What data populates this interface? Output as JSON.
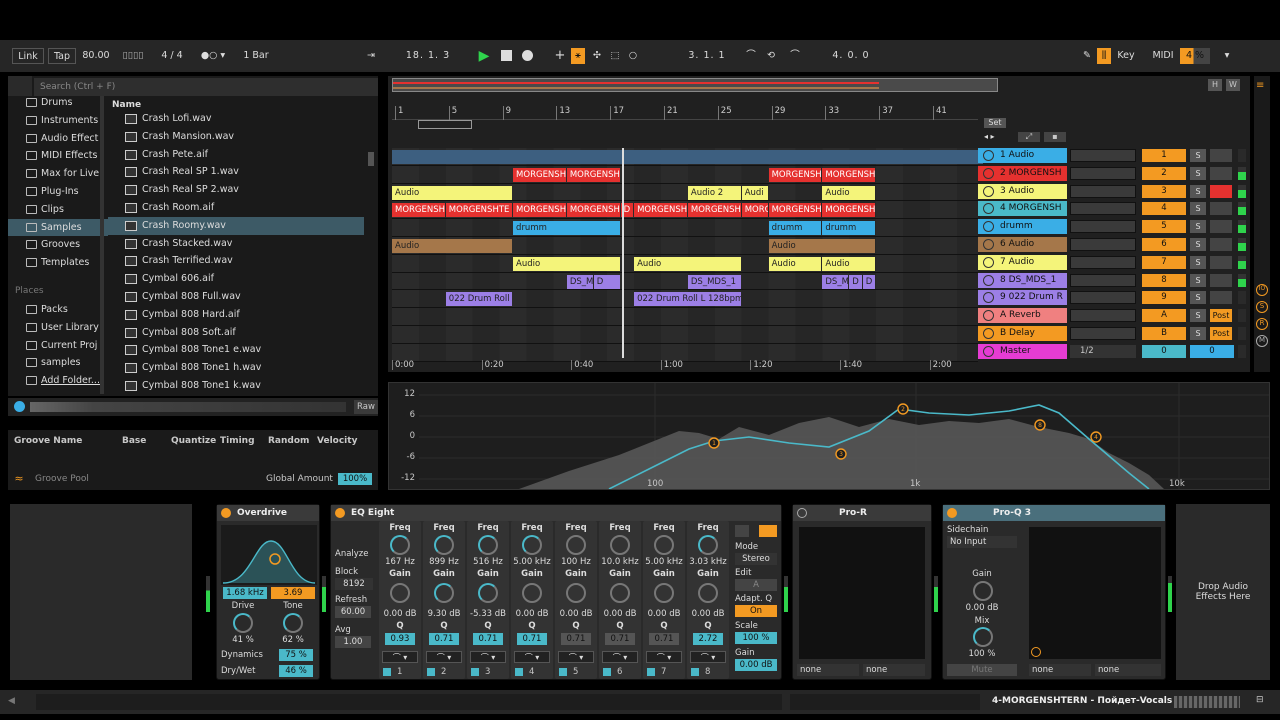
{
  "transport": {
    "link": "Link",
    "tap": "Tap",
    "tempo": "80.00",
    "meter": "4 / 4",
    "quant": "1 Bar",
    "pos": "18. 1. 3",
    "loop_start": "3. 1. 1",
    "loop_len": "4. 0. 0",
    "key": "Key",
    "midi": "MIDI",
    "cpu": "4 %"
  },
  "browser": {
    "search": "Search (Ctrl + F)",
    "name_header": "Name",
    "categories": [
      "Drums",
      "Instruments",
      "Audio Effect",
      "MIDI Effects",
      "Max for Live",
      "Plug-Ins",
      "Clips",
      "Samples",
      "Grooves",
      "Templates"
    ],
    "places_title": "Places",
    "places": [
      "Packs",
      "User Library",
      "Current Proj",
      "samples",
      "Add Folder..."
    ],
    "files": [
      "Crash Lofi.wav",
      "Crash Mansion.wav",
      "Crash Pete.aif",
      "Crash Real SP 1.wav",
      "Crash Real SP 2.wav",
      "Crash Room.aif",
      "Crash Roomy.wav",
      "Crash Stacked.wav",
      "Crash Terrified.wav",
      "Cymbal 606.aif",
      "Cymbal 808 Full.wav",
      "Cymbal 808 Hard.aif",
      "Cymbal 808 Soft.aif",
      "Cymbal 808 Tone1 e.wav",
      "Cymbal 808 Tone1 h.wav",
      "Cymbal 808 Tone1 k.wav"
    ],
    "raw": "Raw"
  },
  "groove": {
    "headers": [
      "Groove Name",
      "Base",
      "Quantize",
      "Timing",
      "Random",
      "Velocity"
    ],
    "pool": "Groove Pool",
    "global": "Global Amount",
    "amount": "100%"
  },
  "ruler": [
    "1",
    "5",
    "9",
    "13",
    "17",
    "21",
    "25",
    "29",
    "33",
    "37",
    "41"
  ],
  "timeline": [
    "0:00",
    "0:20",
    "0:40",
    "1:00",
    "1:20",
    "1:40",
    "2:00"
  ],
  "set": "Set",
  "clips": {
    "morgensh": "MORGENSH",
    "morgenshte": "MORGENSHTE",
    "morge": "MORGE",
    "audio": "Audio",
    "audio2": "Audio 2",
    "audi": "Audi",
    "drumm": "drumm",
    "drum_roll": "022 Drum Roll",
    "drum_roll_long": "022 Drum Roll L 128bpm",
    "ds": "DS_M",
    "ds_mds": "DS_MDS_1",
    "d": "D"
  },
  "tracks": [
    {
      "name": "1 Audio",
      "num": "1"
    },
    {
      "name": "2 MORGENSH",
      "num": "2"
    },
    {
      "name": "3 Audio",
      "num": "3"
    },
    {
      "name": "4 MORGENSH",
      "num": "4"
    },
    {
      "name": "drumm",
      "num": "5"
    },
    {
      "name": "6 Audio",
      "num": "6"
    },
    {
      "name": "7 Audio",
      "num": "7"
    },
    {
      "name": "8 DS_MDS_1",
      "num": "8"
    },
    {
      "name": "9 022 Drum R",
      "num": "9"
    },
    {
      "name": "A Reverb",
      "num": "A"
    },
    {
      "name": "B Delay",
      "num": "B"
    },
    {
      "name": "Master",
      "num": "0"
    }
  ],
  "mixer": {
    "solo": "S",
    "post": "Post",
    "ratio": "1/2",
    "master_val": "0"
  },
  "eq_display": {
    "db": [
      "12",
      "6",
      "0",
      "-6",
      "-12"
    ],
    "freq": [
      "100",
      "1k",
      "10k"
    ]
  },
  "devices": {
    "overdrive": {
      "title": "Overdrive",
      "freq": "1.68 kHz",
      "width": "3.69",
      "drive_lbl": "Drive",
      "tone_lbl": "Tone",
      "drive": "41 %",
      "tone": "62 %",
      "dyn_lbl": "Dynamics",
      "dyn": "75 %",
      "dw_lbl": "Dry/Wet",
      "dw": "46 %"
    },
    "eq8": {
      "title": "EQ Eight",
      "analyze": "Analyze",
      "block_lbl": "Block",
      "block": "8192",
      "refresh_lbl": "Refresh",
      "refresh": "60.00",
      "avg_lbl": "Avg",
      "avg": "1.00",
      "freq_lbl": "Freq",
      "gain_lbl": "Gain",
      "q_lbl": "Q",
      "bands": [
        {
          "f": "167 Hz",
          "g": "0.00 dB",
          "q": "0.93",
          "n": "1"
        },
        {
          "f": "899 Hz",
          "g": "9.30 dB",
          "q": "0.71",
          "n": "2"
        },
        {
          "f": "516 Hz",
          "g": "-5.33 dB",
          "q": "0.71",
          "n": "3"
        },
        {
          "f": "5.00 kHz",
          "g": "0.00 dB",
          "q": "0.71",
          "n": "4"
        },
        {
          "f": "100 Hz",
          "g": "0.00 dB",
          "q": "0.71",
          "n": "5"
        },
        {
          "f": "10.0 kHz",
          "g": "0.00 dB",
          "q": "0.71",
          "n": "6"
        },
        {
          "f": "5.00 kHz",
          "g": "0.00 dB",
          "q": "0.71",
          "n": "7"
        },
        {
          "f": "3.03 kHz",
          "g": "0.00 dB",
          "q": "2.72",
          "n": "8"
        }
      ],
      "mode_lbl": "Mode",
      "mode": "Stereo",
      "edit_lbl": "Edit",
      "edit": "A",
      "adapt_lbl": "Adapt. Q",
      "adapt": "On",
      "scale_lbl": "Scale",
      "scale": "100 %",
      "gain_out_lbl": "Gain",
      "gain_out": "0.00 dB"
    },
    "pror": {
      "title": "Pro-R",
      "none1": "none",
      "none2": "none"
    },
    "proq": {
      "title": "Pro-Q 3",
      "sidechain_lbl": "Sidechain",
      "sidechain": "No Input",
      "gain_lbl": "Gain",
      "gain": "0.00 dB",
      "mix_lbl": "Mix",
      "mix": "100 %",
      "mute": "Mute",
      "none1": "none",
      "none2": "none"
    },
    "drop": "Drop Audio Effects Here"
  },
  "status": {
    "track": "4-MORGENSHTERN - Пойдет-Vocals"
  },
  "colors": {
    "accent": "#f39a22",
    "cyan": "#4ab9c9",
    "red": "#e5312f",
    "yellow": "#f4f47a",
    "blue": "#3aaee6",
    "purple": "#9c7fe6",
    "brown": "#a5774a"
  }
}
